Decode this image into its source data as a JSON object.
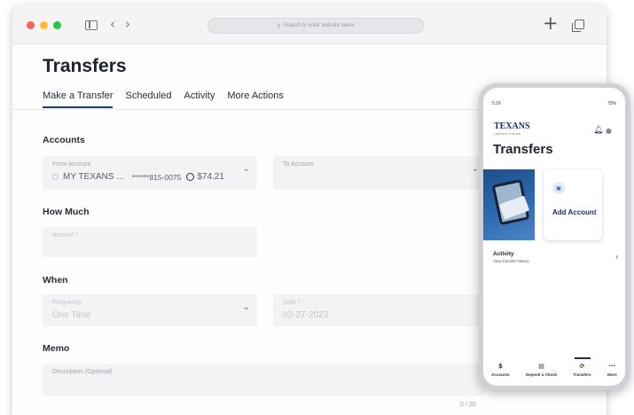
{
  "browser": {
    "traffic_colors": [
      "#ff5f57",
      "#febc2e",
      "#28c840"
    ],
    "url_placeholder": "Search or enter website name",
    "back_glyph": "‹",
    "forward_glyph": "›",
    "new_tab_glyph": "+",
    "icons": [
      "sidebar-icon",
      "back-icon",
      "forward-icon",
      "search-icon",
      "new-tab-icon",
      "tabs-overview-icon"
    ]
  },
  "page": {
    "title": "Transfers",
    "tabs": [
      {
        "label": "Make a Transfer",
        "active": true
      },
      {
        "label": "Scheduled",
        "active": false
      },
      {
        "label": "Activity",
        "active": false
      },
      {
        "label": "More Actions",
        "active": false
      }
    ],
    "accounts": {
      "heading": "Accounts",
      "from": {
        "label": "From Account",
        "name": "MY TEXANS ...",
        "number": "******815-0075",
        "balance": "$74.21"
      },
      "to": {
        "label": "To Account"
      }
    },
    "how_much": {
      "heading": "How Much",
      "amount_label": "Amount *"
    },
    "when": {
      "heading": "When",
      "frequency_label": "Frequency",
      "frequency_value": "One Time",
      "date_label": "Date *",
      "date_value": "02-27-2023"
    },
    "memo": {
      "heading": "Memo",
      "placeholder": "Description (Optional)",
      "counter": "0 / 20"
    }
  },
  "phone": {
    "status_time": "5:16",
    "status_right": "75%",
    "logo": "TEXANS",
    "logo_sub": "CREDIT UNION",
    "title": "Transfers",
    "add_account": "Add Account",
    "activity_title": "Activity",
    "activity_sub": "View transfer history",
    "nav": [
      {
        "label": "Accounts",
        "glyph": "$",
        "active": false
      },
      {
        "label": "Deposit a Check",
        "glyph": "▤",
        "active": false
      },
      {
        "label": "Transfers",
        "glyph": "⟳",
        "active": true
      },
      {
        "label": "More",
        "glyph": "···",
        "active": false
      }
    ]
  },
  "colors": {
    "accent": "#203a75",
    "field_bg": "#f3f3f6",
    "brand_navy": "#1b2d5a"
  }
}
